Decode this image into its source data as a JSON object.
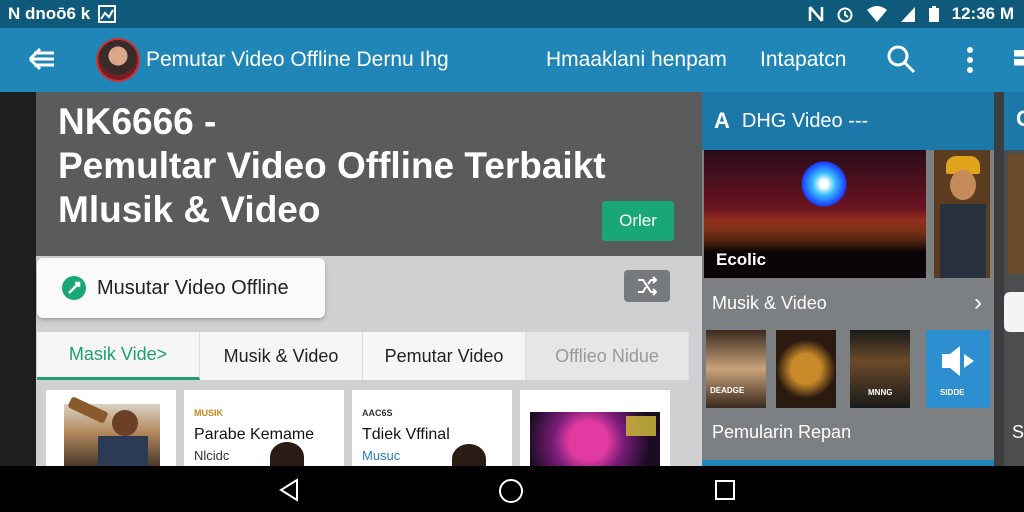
{
  "status_bar": {
    "left_text": "N dnoō6 k",
    "time": "12:36 M",
    "icons": [
      "notification-n-icon",
      "nfc-icon",
      "alarm-icon",
      "wifi-icon",
      "signal-icon",
      "battery-icon"
    ]
  },
  "app_bar": {
    "title": "Pemutar Video Offline Dernu Ihg",
    "menu_item_1": "Hmaaklani henpam",
    "menu_item_2": "Intapatcn",
    "icons": [
      "back-arrow-icon",
      "search-icon",
      "more-vert-icon"
    ]
  },
  "hero": {
    "title_line_1": "NK6666 -",
    "title_line_2": "Pemultar Video Offline Terbaikt",
    "title_line_3": "Mlusik & Video",
    "button_label": "Orler"
  },
  "pill": {
    "label": "Musutar Video Offline"
  },
  "tabs": [
    {
      "label": "Masik Vide>",
      "state": "active"
    },
    {
      "label": "Musik & Video",
      "state": "normal"
    },
    {
      "label": "Pemutar Video",
      "state": "normal"
    },
    {
      "label": "Offlieo Nidue",
      "state": "disabled"
    }
  ],
  "cards": [
    {
      "tiny": "",
      "title": "",
      "subtitle": ""
    },
    {
      "tiny": "MUSIK",
      "title": "Parabe Kemame",
      "subtitle": "Nlcidc"
    },
    {
      "tiny": "AAC6S",
      "title": "Tdiek Vffinal",
      "subtitle": "Musuc"
    },
    {
      "tiny": "",
      "title": "",
      "subtitle": ""
    }
  ],
  "right_panel": {
    "header": "DHG Video ---",
    "header_letter": "A",
    "thumb_label": "Ecolic",
    "section_title": "Musik & Video",
    "chevron": "›",
    "small_thumbs": [
      "DEADGE",
      "",
      "MNNG",
      "SIDDE"
    ],
    "bottom_text": "Pemularin Repan"
  },
  "edge": {
    "letter_top": "C",
    "letter_bottom": "S"
  },
  "colors": {
    "app_bar": "#1f86b7",
    "status_bar": "#0f5a7a",
    "accent_green": "#1aa777"
  }
}
